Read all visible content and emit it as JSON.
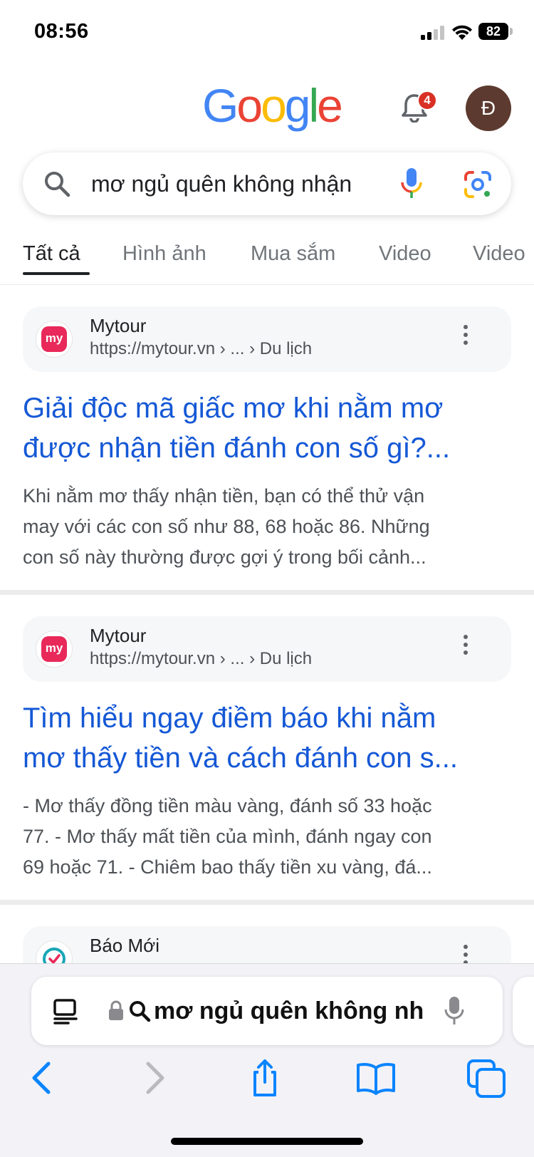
{
  "status_bar": {
    "time": "08:56",
    "battery": "82"
  },
  "header": {
    "logo_letters": [
      {
        "char": "G",
        "color": "#4285F4"
      },
      {
        "char": "o",
        "color": "#EA4335"
      },
      {
        "char": "o",
        "color": "#FBBC05"
      },
      {
        "char": "g",
        "color": "#4285F4"
      },
      {
        "char": "l",
        "color": "#34A853"
      },
      {
        "char": "e",
        "color": "#EA4335"
      }
    ],
    "notification_count": "4",
    "avatar_initial": "Đ"
  },
  "search": {
    "query": "mơ ngủ quên không nhận"
  },
  "tabs": [
    "Tất cả",
    "Hình ảnh",
    "Mua sắm",
    "Video",
    "Video"
  ],
  "results": [
    {
      "site_name": "Mytour",
      "favicon_text": "my",
      "url": "https://mytour.vn › ... › Du lịch",
      "title_lines": [
        "Giải độc mã giấc mơ khi nằm mơ",
        "được nhận tiền đánh con số gì?..."
      ],
      "snippet_lines": [
        "Khi nằm mơ thấy nhận tiền, bạn có thể thử vận",
        "may với các con số như 88, 68 hoặc 86. Những",
        "con số này thường được gợi ý trong bối cảnh..."
      ]
    },
    {
      "site_name": "Mytour",
      "favicon_text": "my",
      "url": "https://mytour.vn › ... › Du lịch",
      "title_lines": [
        "Tìm hiểu ngay điềm báo khi nằm",
        "mơ thấy tiền và cách đánh con s..."
      ],
      "snippet_lines": [
        "- Mơ thấy đồng tiền màu vàng, đánh số 33 hoặc",
        "77. - Mơ thấy mất tiền của mình, đánh ngay con",
        "69 hoặc 71. - Chiêm bao thấy tiền xu vàng, đá..."
      ]
    },
    {
      "site_name": "Báo Mới"
    }
  ],
  "browser": {
    "address_text": "mơ ngủ quên không nh"
  },
  "colors": {
    "link": "#1558d6",
    "accent_blue": "#0a84ff",
    "badge_red": "#d93025",
    "favicon_pink": "#e8295a"
  }
}
